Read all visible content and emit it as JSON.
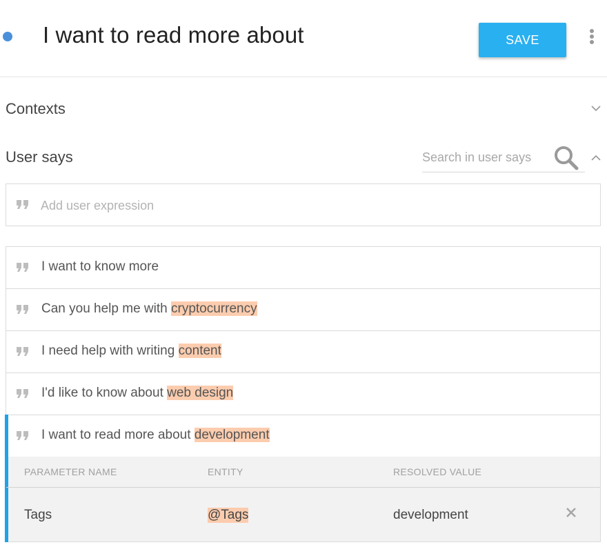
{
  "header": {
    "intent_name": "I want to read more about",
    "save_label": "SAVE",
    "status_color": "#4a90d9",
    "accent_color": "#29b0f0"
  },
  "contexts": {
    "title": "Contexts",
    "expanded": false
  },
  "user_says": {
    "title": "User says",
    "expanded": true,
    "search_placeholder": "Search in user says",
    "add_placeholder": "Add user expression",
    "expressions": [
      {
        "text": "I want to know more",
        "entity": ""
      },
      {
        "text": "Can you help me with ",
        "entity": "cryptocurrency"
      },
      {
        "text": "I need help with writing ",
        "entity": "content"
      },
      {
        "text": "I'd like to know about ",
        "entity": "web design"
      },
      {
        "text": "I want to read more about ",
        "entity": "development"
      }
    ],
    "highlight_color": "#fcccae"
  },
  "parameters": {
    "headers": [
      "PARAMETER NAME",
      "ENTITY",
      "RESOLVED VALUE"
    ],
    "rows": [
      {
        "name": "Tags",
        "entity": "@Tags",
        "value": "development"
      }
    ]
  }
}
